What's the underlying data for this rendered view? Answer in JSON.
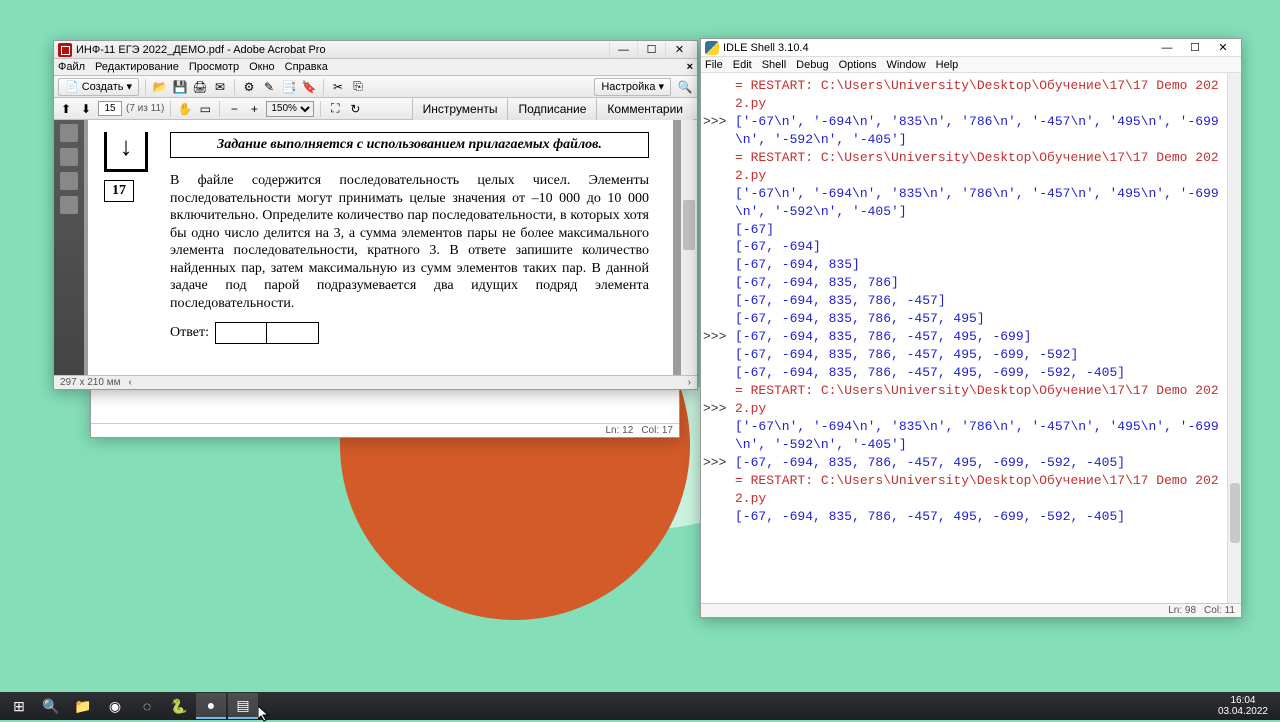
{
  "acrobat": {
    "title": "ИНФ-11 ЕГЭ 2022_ДЕМО.pdf - Adobe Acrobat Pro",
    "menu": [
      "Файл",
      "Редактирование",
      "Просмотр",
      "Окно",
      "Справка"
    ],
    "create_label": "Создать",
    "settings_label": "Настройка",
    "page_num": "15",
    "page_total": "(7 из 11)",
    "zoom": "150%",
    "tabs": [
      "Инструменты",
      "Подписание",
      "Комментарии"
    ],
    "task_header": "Задание выполняется с использованием прилагаемых файлов.",
    "task_number": "17",
    "task_text": "В файле содержится последовательность целых чисел. Элементы последовательности могут принимать целые значения от –10 000 до 10 000 включительно. Определите количество пар последовательности, в которых хотя бы одно число делится на 3, а сумма элементов пары не более максимального элемента последовательности, кратного 3. В ответе запишите количество найденных пар, затем максимальную из сумм элементов таких пар. В данной задаче под парой подразумевается два идущих подряд элемента последовательности.",
    "answer_label": "Ответ:",
    "page_dims": "297 x 210 мм"
  },
  "under": {
    "ln": "Ln: 12",
    "col": "Col: 17"
  },
  "idle": {
    "title": "IDLE Shell 3.10.4",
    "menu": [
      "File",
      "Edit",
      "Shell",
      "Debug",
      "Options",
      "Window",
      "Help"
    ],
    "lines": [
      {
        "g": "",
        "t": "= RESTART: C:\\Users\\University\\Desktop\\Обучение\\17\\17 Demo 2022.py",
        "c": "r"
      },
      {
        "g": "",
        "t": "['-67\\n', '-694\\n', '835\\n', '786\\n', '-457\\n', '495\\n', '-699\\n', '-592\\n', '-405']",
        "c": "b"
      },
      {
        "g": ">>>",
        "t": "",
        "c": ""
      },
      {
        "g": "",
        "t": "= RESTART: C:\\Users\\University\\Desktop\\Обучение\\17\\17 Demo 2022.py",
        "c": "r"
      },
      {
        "g": "",
        "t": "['-67\\n', '-694\\n', '835\\n', '786\\n', '-457\\n', '495\\n', '-699\\n', '-592\\n', '-405']",
        "c": "b"
      },
      {
        "g": "",
        "t": "[-67]",
        "c": "b"
      },
      {
        "g": "",
        "t": "[-67, -694]",
        "c": "b"
      },
      {
        "g": "",
        "t": "[-67, -694, 835]",
        "c": "b"
      },
      {
        "g": "",
        "t": "[-67, -694, 835, 786]",
        "c": "b"
      },
      {
        "g": "",
        "t": "[-67, -694, 835, 786, -457]",
        "c": "b"
      },
      {
        "g": "",
        "t": "[-67, -694, 835, 786, -457, 495]",
        "c": "b"
      },
      {
        "g": "",
        "t": "[-67, -694, 835, 786, -457, 495, -699]",
        "c": "b"
      },
      {
        "g": "",
        "t": "[-67, -694, 835, 786, -457, 495, -699, -592]",
        "c": "b"
      },
      {
        "g": "",
        "t": "[-67, -694, 835, 786, -457, 495, -699, -592, -405]",
        "c": "b"
      },
      {
        "g": ">>>",
        "t": "",
        "c": ""
      },
      {
        "g": "",
        "t": "= RESTART: C:\\Users\\University\\Desktop\\Обучение\\17\\17 Demo 2022.py",
        "c": "r"
      },
      {
        "g": "",
        "t": "['-67\\n', '-694\\n', '835\\n', '786\\n', '-457\\n', '495\\n', '-699\\n', '-592\\n', '-405']",
        "c": "b"
      },
      {
        "g": "",
        "t": "[-67, -694, 835, 786, -457, 495, -699, -592, -405]",
        "c": "b"
      },
      {
        "g": ">>>",
        "t": "",
        "c": ""
      },
      {
        "g": "",
        "t": "= RESTART: C:\\Users\\University\\Desktop\\Обучение\\17\\17 Demo 2022.py",
        "c": "r"
      },
      {
        "g": "",
        "t": "[-67, -694, 835, 786, -457, 495, -699, -592, -405]",
        "c": "b"
      },
      {
        "g": ">>>",
        "t": "",
        "c": ""
      }
    ],
    "ln": "Ln: 98",
    "col": "Col: 11"
  },
  "taskbar": {
    "time": "16:04",
    "date": "03.04.2022",
    "items": [
      {
        "name": "start-button",
        "glyph": "⊞"
      },
      {
        "name": "search-button",
        "glyph": "🔍"
      },
      {
        "name": "explorer-icon",
        "glyph": "📁"
      },
      {
        "name": "chrome-icon",
        "glyph": "◉"
      },
      {
        "name": "discord-icon",
        "glyph": "◌"
      },
      {
        "name": "python-icon",
        "glyph": "🐍"
      },
      {
        "name": "obs-icon",
        "glyph": "●"
      },
      {
        "name": "acrobat-icon",
        "glyph": "▤"
      }
    ]
  }
}
